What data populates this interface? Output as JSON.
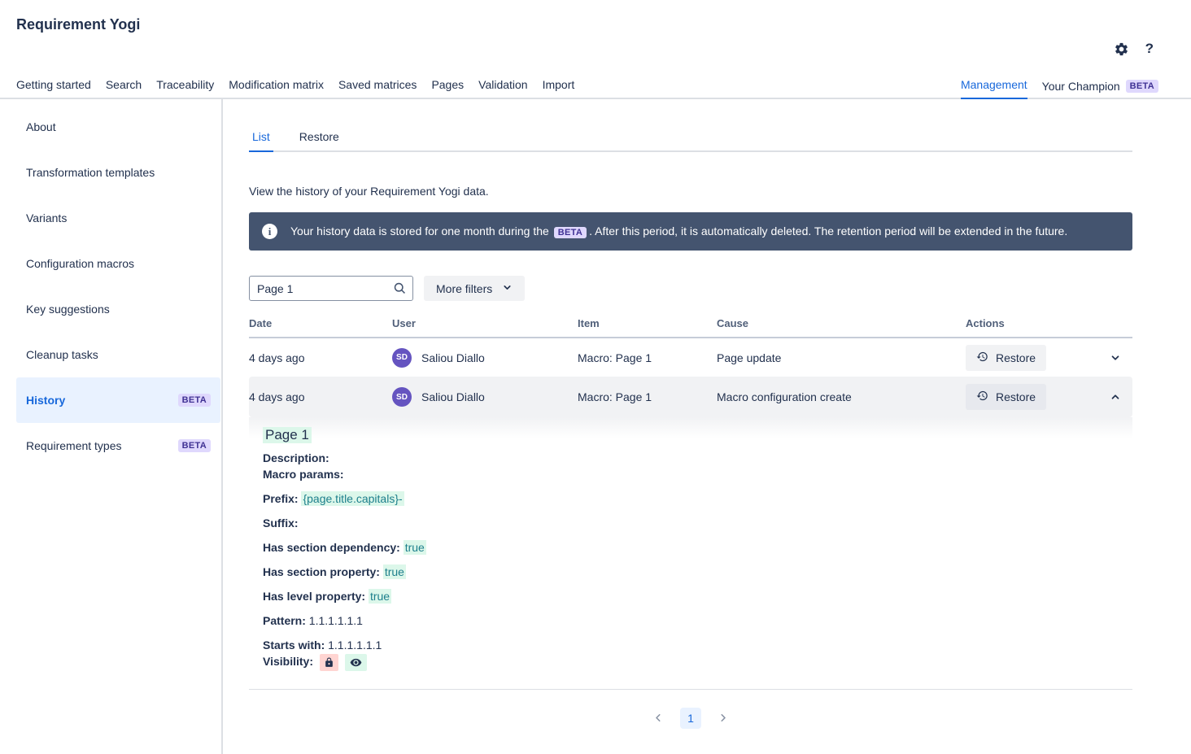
{
  "app": {
    "title": "Requirement Yogi"
  },
  "header": {
    "help_label": "?"
  },
  "nav": {
    "items": [
      "Getting started",
      "Search",
      "Traceability",
      "Modification matrix",
      "Saved matrices",
      "Pages",
      "Validation",
      "Import"
    ],
    "right": {
      "management": "Management",
      "your_champion": "Your Champion",
      "beta_badge": "BETA"
    }
  },
  "sidebar": {
    "items": [
      {
        "label": "About"
      },
      {
        "label": "Transformation templates"
      },
      {
        "label": "Variants"
      },
      {
        "label": "Configuration macros"
      },
      {
        "label": "Key suggestions"
      },
      {
        "label": "Cleanup tasks"
      },
      {
        "label": "History",
        "badge": "BETA"
      },
      {
        "label": "Requirement types",
        "badge": "BETA"
      }
    ]
  },
  "main": {
    "tabs": {
      "list": "List",
      "restore": "Restore"
    },
    "intro": "View the history of your Requirement Yogi data.",
    "banner": {
      "text_before": "Your history data is stored for one month during the",
      "badge": "BETA",
      "text_after": ". After this period, it is automatically deleted. The retention period will be extended in the future."
    },
    "filters": {
      "search_value": "Page 1",
      "more_filters": "More filters"
    },
    "table": {
      "headers": {
        "date": "Date",
        "user": "User",
        "item": "Item",
        "cause": "Cause",
        "actions": "Actions"
      },
      "rows": [
        {
          "date": "4 days ago",
          "user_initials": "SD",
          "user_name": "Saliou Diallo",
          "item": "Macro: Page 1",
          "cause": "Page update",
          "action_label": "Restore"
        },
        {
          "date": "4 days ago",
          "user_initials": "SD",
          "user_name": "Saliou Diallo",
          "item": "Macro: Page 1",
          "cause": "Macro configuration create",
          "action_label": "Restore"
        }
      ]
    },
    "detail": {
      "title": "Page 1",
      "description_label": "Description:",
      "macro_params_label": "Macro params:",
      "fields": [
        {
          "label": "Prefix:",
          "value": "{page.title.capitals}-"
        },
        {
          "label": "Suffix:",
          "value": ""
        },
        {
          "label": "Has section dependency:",
          "value": "true"
        },
        {
          "label": "Has section property:",
          "value": "true"
        },
        {
          "label": "Has level property:",
          "value": "true"
        },
        {
          "label": "Pattern:",
          "value": "1.1.1.1.1.1"
        },
        {
          "label": "Starts with:",
          "value": "1.1.1.1.1.1"
        }
      ],
      "visibility_label": "Visibility:"
    },
    "pagination": {
      "current": "1"
    }
  },
  "colors": {
    "accent_blue": "#1868db",
    "text_navy": "#22314e",
    "banner_bg": "#44546f",
    "selected_bg": "#e9f2ff",
    "beta_badge_bg": "#dfd8fd",
    "beta_badge_text": "#403294",
    "avatar_purple": "#6554c0",
    "highlight_mint": "#dcf7ea",
    "highlight_teal_text": "#1d7f8c",
    "highlight_pink": "#ffd5d2",
    "row_gray": "#f1f2f4"
  }
}
